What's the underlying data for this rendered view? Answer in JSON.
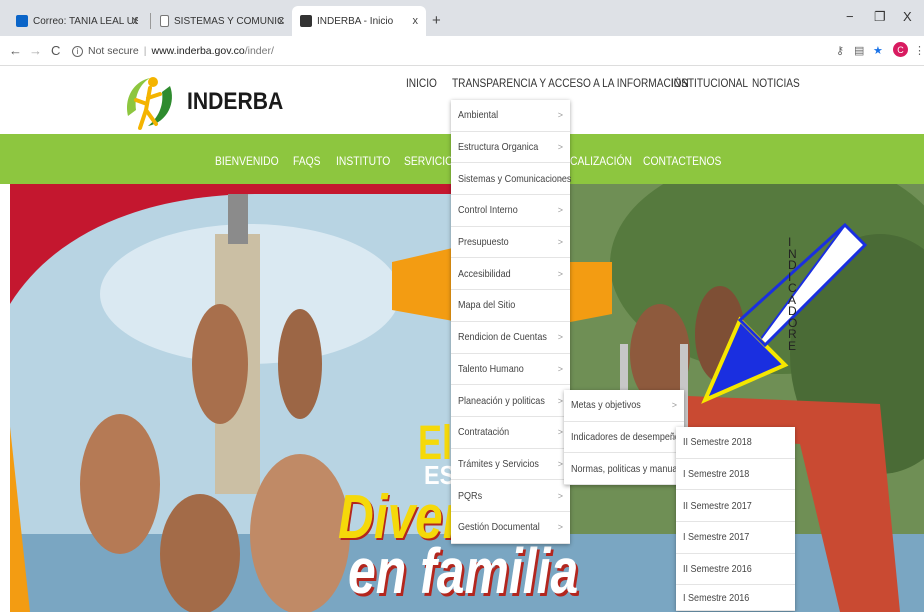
{
  "browser": {
    "tabs": [
      {
        "title": "Correo: TANIA LEAL USURIAGA -",
        "icon": "outlook-icon"
      },
      {
        "title": "SISTEMAS Y COMUNICACIONES",
        "icon": "page-icon"
      },
      {
        "title": "INDERBA - Inicio",
        "icon": "site-favicon"
      }
    ],
    "close_glyph": "x",
    "new_tab_glyph": "+",
    "window_controls": [
      "−",
      "❐",
      "X"
    ],
    "security_label": "Not secure",
    "url_host": "www.inderba.gov.co",
    "url_path": "/inder/",
    "profile_initial": "C"
  },
  "site": {
    "logo_text": "INDERBA",
    "top_nav": [
      "INICIO",
      "TRANSPARENCIA Y ACCESO A LA INFORMACIÓN",
      "INSTITUCIONAL",
      "NOTICIAS"
    ],
    "green_nav": [
      "BIENVENIDO",
      "FAQS",
      "INSTITUTO",
      "SERVICIO",
      "CALIZACIÓN",
      "CONTACTENOS"
    ],
    "accent_color": "#8dc63f"
  },
  "menus": {
    "transparencia": [
      {
        "label": "Ambiental",
        "sub": true
      },
      {
        "label": "Estructura Organica",
        "sub": true
      },
      {
        "label": "Sistemas y Comunicaciones",
        "sub": true
      },
      {
        "label": "Control Interno",
        "sub": true
      },
      {
        "label": "Presupuesto",
        "sub": true
      },
      {
        "label": "Accesibilidad",
        "sub": true
      },
      {
        "label": "Mapa del Sitio",
        "sub": false
      },
      {
        "label": "Rendicion de Cuentas",
        "sub": true
      },
      {
        "label": "Talento Humano",
        "sub": true
      },
      {
        "label": "Planeación y politicas",
        "sub": true
      },
      {
        "label": "Contratación",
        "sub": true
      },
      {
        "label": "Trámites y Servicios",
        "sub": true
      },
      {
        "label": "PQRs",
        "sub": true
      },
      {
        "label": "Gestión Documental",
        "sub": true
      }
    ],
    "planeacion": [
      {
        "label": "Metas y objetivos",
        "sub": true
      },
      {
        "label": "Indicadores de desempeño",
        "sub": true
      },
      {
        "label": "Normas, politicas y manuales",
        "sub": false
      }
    ],
    "indicadores": [
      {
        "label": "II Semestre 2018"
      },
      {
        "label": "I Semestre 2018"
      },
      {
        "label": "II Semestre 2017"
      },
      {
        "label": "I Semestre 2017"
      },
      {
        "label": "II Semestre 2016"
      },
      {
        "label": "I Semestre 2016"
      }
    ],
    "chevron": ">"
  },
  "hero": {
    "line1": "El",
    "line2": "ES",
    "line3": "Diversión",
    "line4": "en familia"
  },
  "annotation": {
    "letters": [
      "I",
      "N",
      "D",
      "I",
      "C",
      "A",
      "D",
      "O",
      "R",
      "E"
    ],
    "arrow_color": "#1a2fe0"
  }
}
